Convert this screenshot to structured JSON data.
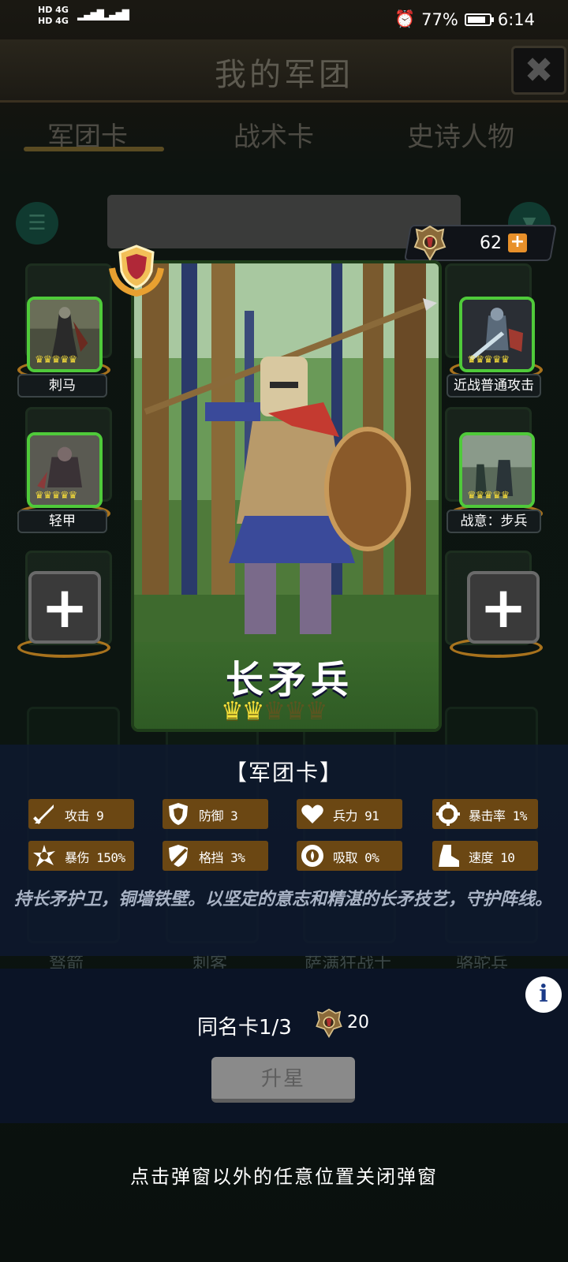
{
  "status_bar": {
    "network_line1": "HD 4G",
    "network_line2": "HD 4G",
    "alarm": "⏰",
    "battery": "77%",
    "time": "6:14"
  },
  "header": {
    "title": "我的军团",
    "close_icon": "✖"
  },
  "tabs": [
    {
      "label": "军团卡",
      "active": true
    },
    {
      "label": "战术卡",
      "active": false
    },
    {
      "label": "史诗人物",
      "active": false
    }
  ],
  "toolbar": {
    "menu_icon": "☰",
    "filter_icon": "▼"
  },
  "currency": {
    "value": "62",
    "plus": "+"
  },
  "skills_left": [
    {
      "label": "刺马",
      "crowns": "♛♛♛♛♛"
    },
    {
      "label": "轻甲",
      "crowns": "♛♛♛♛♛"
    }
  ],
  "skills_right": [
    {
      "label": "近战普通攻击",
      "crowns": "♛♛♛♛♛"
    },
    {
      "label": "战意：步兵",
      "crowns": "♛♛♛♛♛"
    }
  ],
  "add_slot_symbol": "+",
  "card": {
    "name": "长矛兵",
    "stars_on": "♛♛",
    "stars_off": "♛♛♛",
    "star_rating": 2,
    "star_max": 5
  },
  "background_units": [
    "驽箭",
    "刺客",
    "萨满狂战士",
    "骆驼兵"
  ],
  "popup": {
    "title": "【军团卡】",
    "stats": [
      {
        "label": "攻击 9",
        "icon": "sword-icon"
      },
      {
        "label": "防御 3",
        "icon": "shield-icon"
      },
      {
        "label": "兵力 91",
        "icon": "heart-icon"
      },
      {
        "label": "暴击率 1%",
        "icon": "crosshair-icon"
      },
      {
        "label": "暴伤 150%",
        "icon": "burst-icon"
      },
      {
        "label": "格挡 3%",
        "icon": "block-icon"
      },
      {
        "label": "吸取 0%",
        "icon": "drain-icon"
      },
      {
        "label": "速度 10",
        "icon": "boot-icon"
      }
    ],
    "description": "持长矛护卫，铜墙铁壁。以坚定的意志和精湛的长矛技艺，守护阵线。",
    "info_icon": "i",
    "duplicate_label": "同名卡1/3",
    "duplicate_cost": "20",
    "upgrade_label": "升星"
  },
  "hint": "点击弹窗以外的任意位置关闭弹窗",
  "colors": {
    "stat_bg": "#6b4713",
    "skill_border": "#4fca3a",
    "popup_bg": "#0e182e",
    "crown": "#f2e23c",
    "currency_plus": "#e8902a"
  }
}
